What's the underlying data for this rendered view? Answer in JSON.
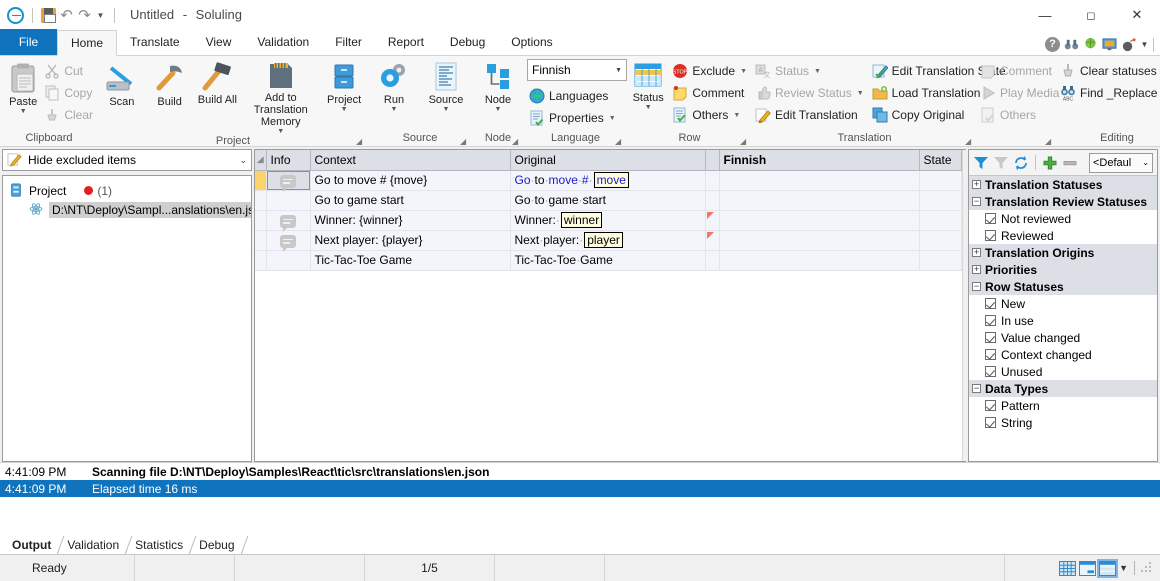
{
  "titlebar": {
    "document": "Untitled",
    "separator": "-",
    "app": "Soluling",
    "quick_access": [
      "app-menu",
      "save",
      "undo",
      "redo",
      "customize"
    ],
    "minimize": "—",
    "maximize": "☐",
    "close": "✕"
  },
  "tabs": [
    {
      "label": "File",
      "active": false,
      "accent": true
    },
    {
      "label": "Home",
      "active": true
    },
    {
      "label": "Translate",
      "active": false
    },
    {
      "label": "View",
      "active": false
    },
    {
      "label": "Validation",
      "active": false
    },
    {
      "label": "Filter",
      "active": false
    },
    {
      "label": "Report",
      "active": false
    },
    {
      "label": "Debug",
      "active": false
    },
    {
      "label": "Options",
      "active": false
    }
  ],
  "help_icons": [
    "help-icon",
    "binoculars-icon",
    "globe-icon",
    "monitor-icon",
    "bomb-icon",
    "chevron-down-icon"
  ],
  "ribbon": {
    "groups": [
      {
        "label": "Clipboard",
        "big": [
          {
            "label": "Paste",
            "icon": "clipboard-icon",
            "caret": true
          }
        ],
        "small": [
          {
            "label": "Cut",
            "icon": "scissors-icon",
            "disabled": true
          },
          {
            "label": "Copy",
            "icon": "copy-icon",
            "disabled": true
          },
          {
            "label": "Clear",
            "icon": "eraser-icon",
            "disabled": true
          }
        ],
        "launcher": false
      },
      {
        "label": "Project",
        "big": [
          {
            "label": "Scan",
            "icon": "scanner-icon"
          },
          {
            "label": "Build",
            "icon": "hammer-icon"
          },
          {
            "label": "Build All",
            "icon": "sledgehammer-icon"
          },
          {
            "label": "Add to Translation Memory",
            "icon": "memorycard-icon",
            "caret": true
          },
          {
            "label": "Project",
            "icon": "cabinet-icon",
            "caret": true
          }
        ],
        "small": [],
        "launcher": true
      },
      {
        "label": "Source",
        "big": [
          {
            "label": "Run",
            "icon": "gears-icon",
            "caret": true
          },
          {
            "label": "Source",
            "icon": "document-icon",
            "caret": true
          }
        ],
        "small": [],
        "launcher": true
      },
      {
        "label": "Node",
        "big": [
          {
            "label": "Node",
            "icon": "tree-nodes-icon",
            "caret": true
          }
        ],
        "small": [],
        "launcher": true
      },
      {
        "label": "Language",
        "combo": {
          "value": "Finnish"
        },
        "small": [
          {
            "label": "Languages",
            "icon": "globe-icon"
          },
          {
            "label": "Properties",
            "icon": "properties-icon",
            "caret": true
          }
        ],
        "launcher": true
      },
      {
        "label": "Row",
        "big": [
          {
            "label": "Status",
            "icon": "status-grid-icon",
            "caret": true
          }
        ],
        "small": [
          {
            "label": "Exclude",
            "icon": "stop-icon",
            "caret": true
          },
          {
            "label": "Comment",
            "icon": "note-icon"
          },
          {
            "label": "Others",
            "icon": "others-icon",
            "caret": true
          }
        ],
        "launcher": true
      },
      {
        "label": "Translation",
        "small": [
          {
            "label": "Status",
            "icon": "translation-status-icon",
            "caret": true,
            "disabled": true
          },
          {
            "label": "Review Status",
            "icon": "thumb-icon",
            "caret": true,
            "disabled": true
          },
          {
            "label": "Edit Translation",
            "icon": "pencil-icon"
          },
          {
            "label": "Edit Translation State",
            "icon": "edit-state-icon"
          },
          {
            "label": "Load Translation",
            "icon": "folder-icon",
            "caret": true
          },
          {
            "label": "Copy Original",
            "icon": "copy-blue-icon"
          }
        ],
        "launcher": true
      },
      {
        "label": "",
        "small": [
          {
            "label": "Comment",
            "icon": "note-gray-icon",
            "disabled": true
          },
          {
            "label": "Play Media",
            "icon": "play-icon",
            "disabled": true
          },
          {
            "label": "Others",
            "icon": "others-gray-icon",
            "caret": true,
            "disabled": true
          }
        ],
        "launcher": true
      },
      {
        "label": "Editing",
        "small": [
          {
            "label": "Clear statuses",
            "icon": "eraser-icon",
            "caret": true
          },
          {
            "label": "Find _Replace",
            "icon": "binoculars-abc-icon",
            "caret": true
          }
        ],
        "launcher": false
      }
    ]
  },
  "left_panel": {
    "filter_combo": {
      "value": "Hide excluded items",
      "icon": "pencil-note-icon"
    },
    "tree": {
      "root": {
        "label": "Project",
        "icon": "project-icon",
        "badge": "(1)",
        "badge_icon": "red-dot-icon"
      },
      "children": [
        {
          "label": "D:\\NT\\Deploy\\Sampl...anslations\\en.json",
          "icon": "react-icon",
          "selected": true
        }
      ]
    }
  },
  "grid": {
    "columns": [
      "",
      "Info",
      "Context",
      "Original",
      "",
      "Finnish",
      "State"
    ],
    "rows": [
      {
        "selected": true,
        "has_comment": true,
        "context": "Go to move # {move}",
        "original_plain": "Go·to·move·#· move",
        "original_parts": [
          {
            "t": "Go",
            "k": "blue"
          },
          {
            "t": "·",
            "k": "mid"
          },
          {
            "t": "to",
            "k": "plain"
          },
          {
            "t": "·",
            "k": "mid"
          },
          {
            "t": "move",
            "k": "blue"
          },
          {
            "t": "·",
            "k": "mid"
          },
          {
            "t": "#",
            "k": "blue"
          },
          {
            "t": "·",
            "k": "mid"
          },
          {
            "t": "move",
            "k": "token-blue"
          }
        ],
        "flag": false,
        "finnish": "",
        "state": ""
      },
      {
        "selected": false,
        "has_comment": false,
        "context": "Go to game start",
        "original_plain": "Go·to·game·start",
        "original_parts": [
          {
            "t": "Go",
            "k": "plain"
          },
          {
            "t": "·",
            "k": "mid"
          },
          {
            "t": "to",
            "k": "plain"
          },
          {
            "t": "·",
            "k": "mid"
          },
          {
            "t": "game",
            "k": "plain"
          },
          {
            "t": "·",
            "k": "mid"
          },
          {
            "t": "start",
            "k": "plain"
          }
        ],
        "flag": false,
        "finnish": "",
        "state": ""
      },
      {
        "selected": false,
        "has_comment": true,
        "context": "Winner: {winner}",
        "original_plain": "Winner:· winner",
        "original_parts": [
          {
            "t": "Winner:",
            "k": "plain"
          },
          {
            "t": "·",
            "k": "mid"
          },
          {
            "t": "winner",
            "k": "token"
          }
        ],
        "flag": true,
        "finnish": "",
        "state": ""
      },
      {
        "selected": false,
        "has_comment": true,
        "context": "Next player: {player}",
        "original_plain": "Next·player:· player",
        "original_parts": [
          {
            "t": "Next",
            "k": "plain"
          },
          {
            "t": "·",
            "k": "mid"
          },
          {
            "t": "player:",
            "k": "plain"
          },
          {
            "t": "·",
            "k": "mid"
          },
          {
            "t": "player",
            "k": "token"
          }
        ],
        "flag": true,
        "finnish": "",
        "state": ""
      },
      {
        "selected": false,
        "has_comment": false,
        "context": "Tic-Tac-Toe Game",
        "original_plain": "Tic-Tac-Toe·Game",
        "original_parts": [
          {
            "t": "Tic-Tac-Toe",
            "k": "plain"
          },
          {
            "t": "·",
            "k": "mid"
          },
          {
            "t": "Game",
            "k": "plain"
          }
        ],
        "flag": false,
        "finnish": "",
        "state": ""
      }
    ]
  },
  "filter_panel": {
    "toolbar": {
      "icons": [
        "filter-icon",
        "filter-off-icon",
        "refresh-icon",
        "add-icon",
        "remove-icon"
      ],
      "preset": "<Defaul"
    },
    "groups": [
      {
        "label": "Translation Statuses",
        "expanded": false,
        "items": []
      },
      {
        "label": "Translation Review Statuses",
        "expanded": true,
        "items": [
          {
            "label": "Not reviewed",
            "checked": true
          },
          {
            "label": "Reviewed",
            "checked": true
          }
        ]
      },
      {
        "label": "Translation Origins",
        "expanded": false,
        "items": []
      },
      {
        "label": "Priorities",
        "expanded": false,
        "items": []
      },
      {
        "label": "Row Statuses",
        "expanded": true,
        "items": [
          {
            "label": "New",
            "checked": true
          },
          {
            "label": "In use",
            "checked": true
          },
          {
            "label": "Value changed",
            "checked": true
          },
          {
            "label": "Context changed",
            "checked": true
          },
          {
            "label": "Unused",
            "checked": true
          }
        ]
      },
      {
        "label": "Data Types",
        "expanded": true,
        "items": [
          {
            "label": "Pattern",
            "checked": true
          },
          {
            "label": "String",
            "checked": true
          }
        ]
      }
    ]
  },
  "output": {
    "rows": [
      {
        "time": "4:41:09 PM",
        "message": "Scanning file D:\\NT\\Deploy\\Samples\\React\\tic\\src\\translations\\en.json",
        "selected": false
      },
      {
        "time": "4:41:09 PM",
        "message": "Elapsed time 16 ms",
        "selected": true
      }
    ],
    "tabs": [
      {
        "label": "Output",
        "active": true
      },
      {
        "label": "Validation",
        "active": false
      },
      {
        "label": "Statistics",
        "active": false
      },
      {
        "label": "Debug",
        "active": false
      }
    ]
  },
  "statusbar": {
    "ready": "Ready",
    "position": "1/5",
    "view_icons": [
      "grid-view-icon",
      "split-view-icon",
      "form-view-icon",
      "view-dropdown-icon"
    ]
  },
  "colors": {
    "accent": "#0f73bd",
    "ribbon_bg": "#f7f7f7",
    "grid_header": "#dcdfe6",
    "row_bg": "#f4f4fb",
    "target_cell": "#fffef0",
    "selection": "#fcd469",
    "flag": "#f4736b"
  }
}
